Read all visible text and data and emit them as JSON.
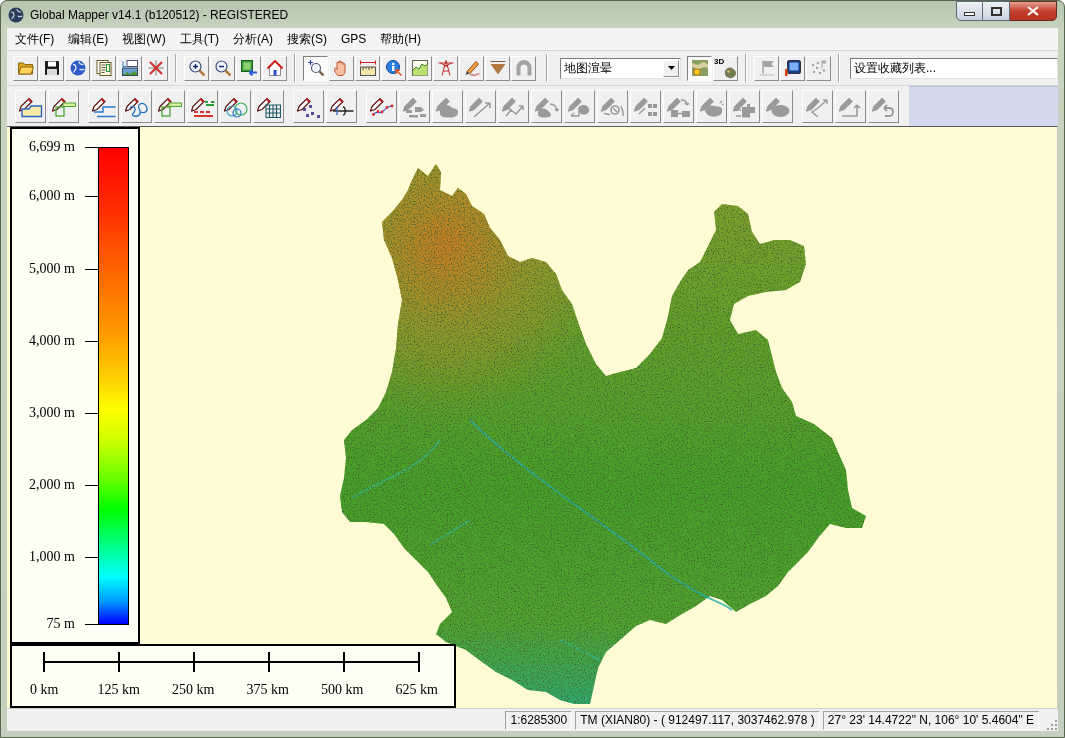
{
  "window": {
    "title": "Global Mapper v14.1 (b120512) - REGISTERED"
  },
  "menu": [
    "文件(F)",
    "编辑(E)",
    "视图(W)",
    "工具(T)",
    "分析(A)",
    "搜索(S)",
    "GPS",
    "帮助(H)"
  ],
  "toolbar_1": [
    {
      "items": [
        {
          "kind": "open",
          "selected": false,
          "disabled": false
        },
        {
          "kind": "save",
          "selected": false,
          "disabled": false
        },
        {
          "kind": "globe",
          "selected": false,
          "disabled": false
        },
        {
          "kind": "layout",
          "selected": false,
          "disabled": false
        },
        {
          "kind": "export",
          "selected": false,
          "disabled": false
        },
        {
          "kind": "tools",
          "selected": false,
          "disabled": false
        }
      ]
    },
    {
      "items": [
        {
          "kind": "zoomin",
          "selected": false,
          "disabled": false
        },
        {
          "kind": "zoomout",
          "selected": false,
          "disabled": false
        },
        {
          "kind": "extent",
          "selected": false,
          "disabled": false
        },
        {
          "kind": "home",
          "selected": false,
          "disabled": false
        }
      ]
    },
    {
      "items": [
        {
          "kind": "zoomtool",
          "selected": true,
          "disabled": false
        },
        {
          "kind": "pan",
          "selected": false,
          "disabled": false
        },
        {
          "kind": "measure",
          "selected": false,
          "disabled": false
        },
        {
          "kind": "info",
          "selected": false,
          "disabled": false
        },
        {
          "kind": "profile",
          "selected": false,
          "disabled": false
        },
        {
          "kind": "tower",
          "selected": false,
          "disabled": false
        },
        {
          "kind": "digitize",
          "selected": false,
          "disabled": false
        },
        {
          "kind": "more",
          "selected": false,
          "disabled": false
        },
        {
          "kind": "arch",
          "selected": false,
          "disabled": true
        }
      ]
    },
    {
      "items": [
        {
          "kind": "dropdown",
          "value": "地图渲晕"
        },
        {
          "kind": "shader",
          "selected": true,
          "disabled": false
        },
        {
          "kind": "view3d",
          "label": "3D",
          "selected": false,
          "disabled": false
        }
      ]
    },
    {
      "items": [
        {
          "kind": "flag",
          "selected": false,
          "disabled": true
        },
        {
          "kind": "monitor",
          "selected": false,
          "disabled": false
        },
        {
          "kind": "gps",
          "selected": false,
          "disabled": true
        }
      ]
    },
    {
      "items": [
        {
          "kind": "field",
          "value": "设置收藏列表..."
        }
      ]
    }
  ],
  "toolbar_2": [
    {
      "items": [
        {
          "kind": "area",
          "disabled": false
        },
        {
          "kind": "box",
          "disabled": false
        }
      ]
    },
    {
      "items": [
        {
          "kind": "steps",
          "disabled": false
        },
        {
          "kind": "loops",
          "disabled": false
        },
        {
          "kind": "box",
          "disabled": false
        },
        {
          "kind": "cogo",
          "disabled": false
        },
        {
          "kind": "rings",
          "disabled": false
        },
        {
          "kind": "grid",
          "disabled": false
        }
      ]
    },
    {
      "items": [
        {
          "kind": "points",
          "disabled": false
        },
        {
          "kind": "cross",
          "disabled": false
        }
      ]
    },
    {
      "items": [
        {
          "kind": "vertices",
          "disabled": false
        },
        {
          "kind": "scatter",
          "disabled": true
        },
        {
          "kind": "blob",
          "disabled": true
        },
        {
          "kind": "arrowline",
          "disabled": true
        },
        {
          "kind": "branch",
          "disabled": true
        },
        {
          "kind": "cycle",
          "disabled": true
        },
        {
          "kind": "split",
          "disabled": true
        },
        {
          "kind": "wave",
          "disabled": true
        },
        {
          "kind": "cells",
          "disabled": true
        },
        {
          "kind": "swap",
          "disabled": true
        },
        {
          "kind": "burst",
          "disabled": true
        },
        {
          "kind": "blocks",
          "disabled": true
        },
        {
          "kind": "oval",
          "disabled": true
        }
      ]
    },
    {
      "items": [
        {
          "kind": "chevron",
          "disabled": true
        },
        {
          "kind": "corner",
          "disabled": true
        },
        {
          "kind": "undo",
          "disabled": true
        }
      ]
    }
  ],
  "elevation_legend": {
    "labels": [
      "6,699 m",
      "6,000 m",
      "5,000 m",
      "4,000 m",
      "3,000 m",
      "2,000 m",
      "1,000 m",
      "75 m"
    ]
  },
  "scale_bar": {
    "labels": [
      "0 km",
      "125 km",
      "250 km",
      "375 km",
      "500 km",
      "625 km"
    ]
  },
  "status_bar": {
    "panels": [
      "1:6285300",
      "TM (XIAN80) - ( 912497.117, 3037462.978 )",
      "27° 23' 14.4722\" N, 106° 10' 5.4604\" E"
    ]
  }
}
